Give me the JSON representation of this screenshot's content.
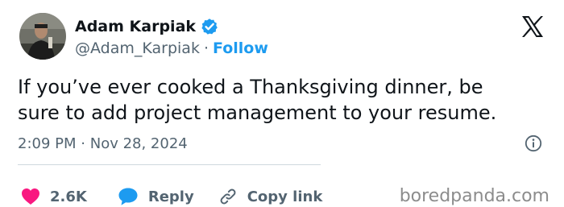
{
  "author": {
    "display_name": "Adam Karpiak",
    "handle": "@Adam_Karpiak",
    "separator": "·",
    "follow_label": "Follow",
    "verified_color": "#1d9bf0"
  },
  "tweet": {
    "text_lines": [
      "If you’ve ever cooked a Thanksgiving dinner, be",
      "sure to add project management to your resume."
    ],
    "time": "2:09 PM",
    "date_separator": "·",
    "date": "Nov 28, 2024"
  },
  "actions": {
    "likes": "2.6K",
    "reply_label": "Reply",
    "copy_label": "Copy link",
    "like_color": "#f91880",
    "reply_color": "#1d9bf0"
  },
  "icons": {
    "brand": "x-logo-icon",
    "info": "info-icon",
    "like": "heart-icon",
    "reply": "speech-bubble-icon",
    "copy": "link-icon"
  },
  "watermark": "boredpanda.com"
}
